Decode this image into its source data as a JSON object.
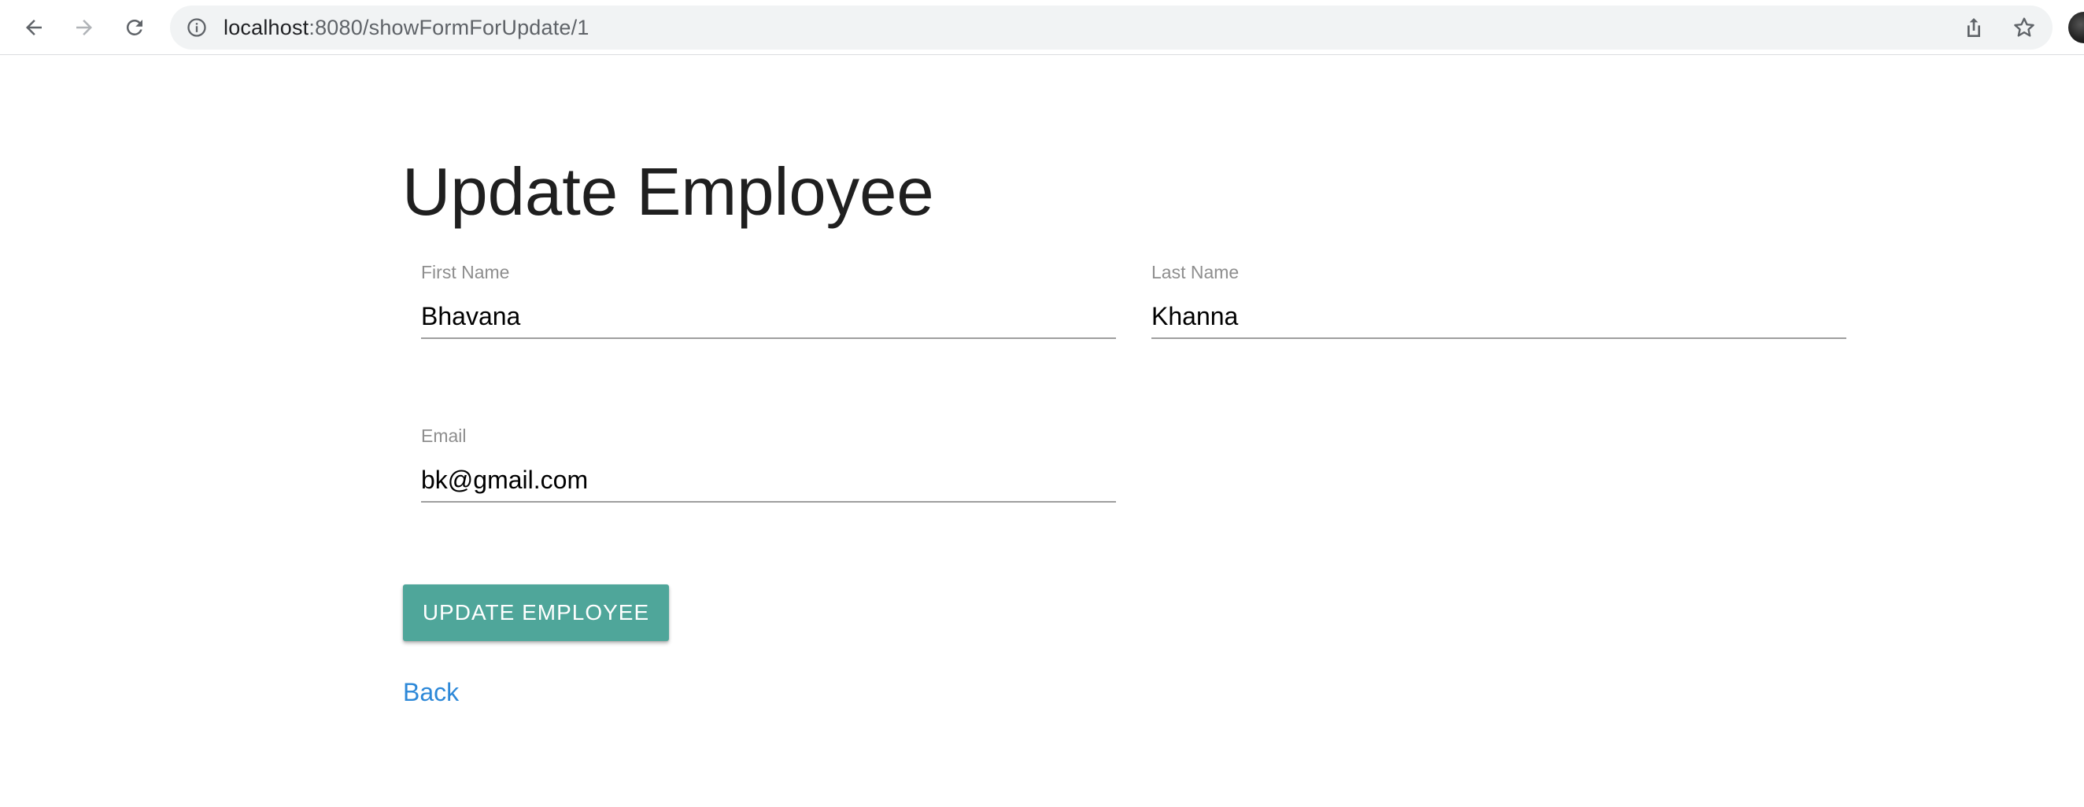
{
  "browser": {
    "url_host": "localhost",
    "url_path": ":8080/showFormForUpdate/1"
  },
  "icons": {
    "back": "arrow-left-icon",
    "forward": "arrow-right-icon",
    "reload": "reload-icon",
    "site_info": "info-circle-icon",
    "share": "share-icon",
    "bookmark": "star-icon"
  },
  "page": {
    "title": "Update Employee"
  },
  "form": {
    "first_name": {
      "label": "First Name",
      "value": "Bhavana"
    },
    "last_name": {
      "label": "Last Name",
      "value": "Khanna"
    },
    "email": {
      "label": "Email",
      "value": "bk@gmail.com"
    },
    "submit_label": "UPDATE EMPLOYEE",
    "back_label": "Back"
  },
  "colors": {
    "button": "#4fa69a",
    "link": "#2d88d8",
    "label": "#8e8e8e"
  }
}
